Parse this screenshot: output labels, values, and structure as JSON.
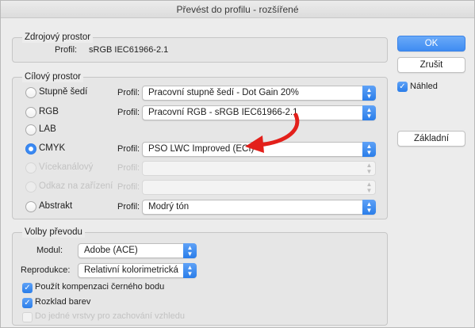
{
  "window": {
    "title": "Převést do profilu - rozšířené"
  },
  "source": {
    "legend": "Zdrojový prostor",
    "profile_label": "Profil:",
    "profile_value": "sRGB IEC61966-2.1"
  },
  "target": {
    "legend": "Cílový prostor",
    "profile_label": "Profil:",
    "rows": [
      {
        "label": "Stupně šedí",
        "profile": "Pracovní stupně šedí - Dot Gain 20%",
        "selected": false,
        "enabled": true
      },
      {
        "label": "RGB",
        "profile": "Pracovní RGB - sRGB IEC61966-2.1",
        "selected": false,
        "enabled": true
      },
      {
        "label": "LAB",
        "profile": "",
        "selected": false,
        "enabled": true
      },
      {
        "label": "CMYK",
        "profile": "PSO LWC Improved (ECI)",
        "selected": true,
        "enabled": true
      },
      {
        "label": "Vícekanálový",
        "profile": "",
        "selected": false,
        "enabled": false
      },
      {
        "label": "Odkaz na zařízení",
        "profile": "",
        "selected": false,
        "enabled": false
      },
      {
        "label": "Abstrakt",
        "profile": "Modrý tón",
        "selected": false,
        "enabled": true
      }
    ]
  },
  "conversion": {
    "legend": "Volby převodu",
    "module_label": "Modul:",
    "module_value": "Adobe (ACE)",
    "intent_label": "Reprodukce:",
    "intent_value": "Relativní kolorimetrická",
    "options": [
      {
        "label": "Použít kompenzaci černého bodu",
        "checked": true,
        "enabled": true
      },
      {
        "label": "Rozklad barev",
        "checked": true,
        "enabled": true
      },
      {
        "label": "Do jedné vrstvy pro zachování vzhledu",
        "checked": false,
        "enabled": false
      }
    ]
  },
  "buttons": {
    "ok": "OK",
    "cancel": "Zrušit",
    "preview": "Náhled",
    "basic": "Základní"
  },
  "colors": {
    "accent": "#3b8af3",
    "annotation": "#e3201b"
  }
}
